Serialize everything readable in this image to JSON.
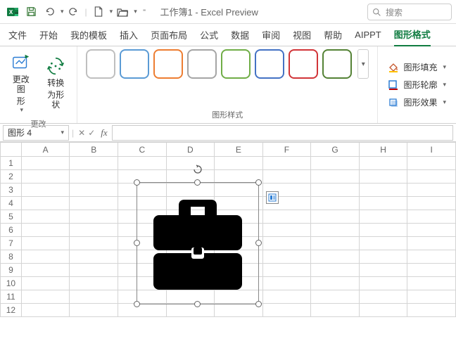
{
  "title": "工作簿1  -  Excel Preview",
  "search_placeholder": "搜索",
  "tabs": [
    "文件",
    "开始",
    "我的模板",
    "插入",
    "页面布局",
    "公式",
    "数据",
    "审阅",
    "视图",
    "帮助",
    "AIPPT",
    "图形格式"
  ],
  "active_tab_index": 11,
  "ribbon": {
    "change_group_label": "更改",
    "change_shape_btn": {
      "line1": "更改图",
      "line2": "形"
    },
    "convert_btn": {
      "line1": "转换",
      "line2": "为形状"
    },
    "styles_label": "图形样式",
    "style_colors": [
      "#bfbfbf",
      "#5b9bd5",
      "#ed7d31",
      "#a5a5a5",
      "#70ad47",
      "#4472c4",
      "#d13438",
      "#548235"
    ],
    "fill_label": "图形填充",
    "outline_label": "图形轮廓",
    "effects_label": "图形效果"
  },
  "namebox_value": "图形 4",
  "columns": [
    "A",
    "B",
    "C",
    "D",
    "E",
    "F",
    "G",
    "H",
    "I"
  ],
  "rows": [
    "1",
    "2",
    "3",
    "4",
    "5",
    "6",
    "7",
    "8",
    "9",
    "10",
    "11",
    "12"
  ]
}
